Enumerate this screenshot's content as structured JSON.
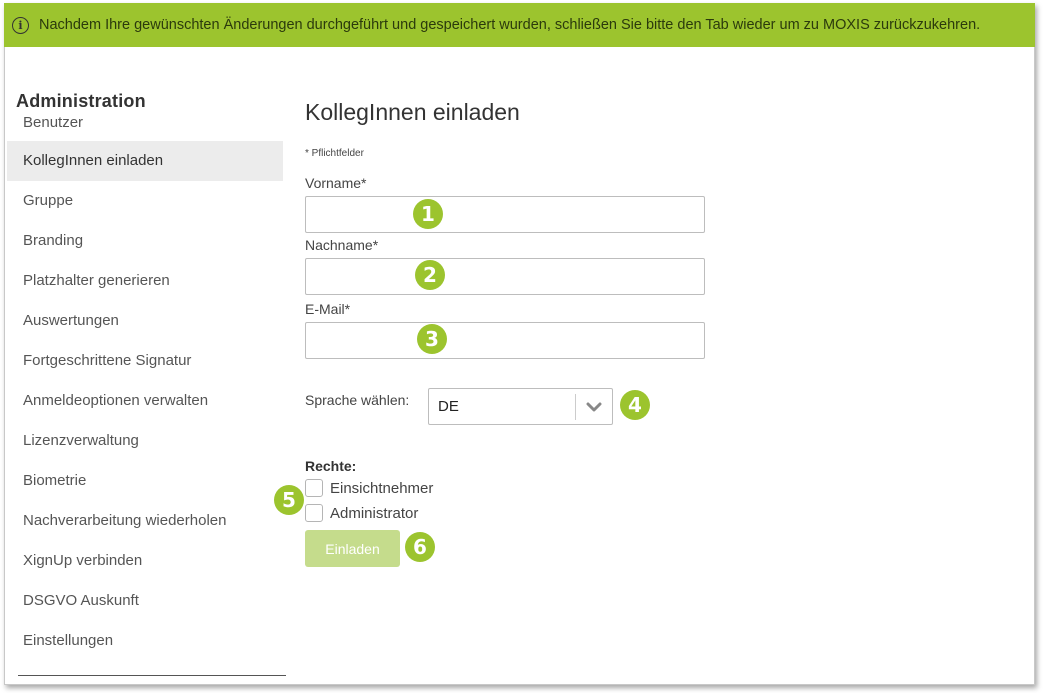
{
  "banner": {
    "text": "Nachdem Ihre gewünschten Änderungen durchgeführt und gespeichert wurden, schließen Sie bitte den Tab wieder um zu MOXIS zurückzukehren.",
    "icon": "info-icon",
    "color": "#9cc42e"
  },
  "sidebar": {
    "title": "Administration",
    "items": [
      {
        "label": "Benutzer"
      },
      {
        "label": "KollegInnen einladen",
        "active": true
      },
      {
        "label": "Gruppe"
      },
      {
        "label": "Branding"
      },
      {
        "label": "Platzhalter generieren"
      },
      {
        "label": "Auswertungen"
      },
      {
        "label": "Fortgeschrittene Signatur"
      },
      {
        "label": "Anmeldeoptionen verwalten"
      },
      {
        "label": "Lizenzverwaltung"
      },
      {
        "label": "Biometrie"
      },
      {
        "label": "Nachverarbeitung wiederholen"
      },
      {
        "label": "XignUp verbinden"
      },
      {
        "label": "DSGVO Auskunft"
      },
      {
        "label": "Einstellungen"
      }
    ]
  },
  "form": {
    "title": "KollegInnen einladen",
    "required_note": "* Pflichtfelder",
    "firstname": {
      "label": "Vorname*",
      "value": "",
      "badge": "1"
    },
    "lastname": {
      "label": "Nachname*",
      "value": "",
      "badge": "2"
    },
    "email": {
      "label": "E-Mail*",
      "value": "",
      "badge": "3"
    },
    "language": {
      "label": "Sprache wählen:",
      "selected": "DE",
      "badge": "4"
    },
    "rights": {
      "label": "Rechte:",
      "badge": "5",
      "options": [
        {
          "label": "Einsichtnehmer",
          "checked": false
        },
        {
          "label": "Administrator",
          "checked": false
        }
      ]
    },
    "submit": {
      "label": "Einladen",
      "badge": "6"
    }
  },
  "colors": {
    "accent": "#9cc42e",
    "button_disabled": "#c5dc8c",
    "active_item_bg": "#ececec"
  }
}
